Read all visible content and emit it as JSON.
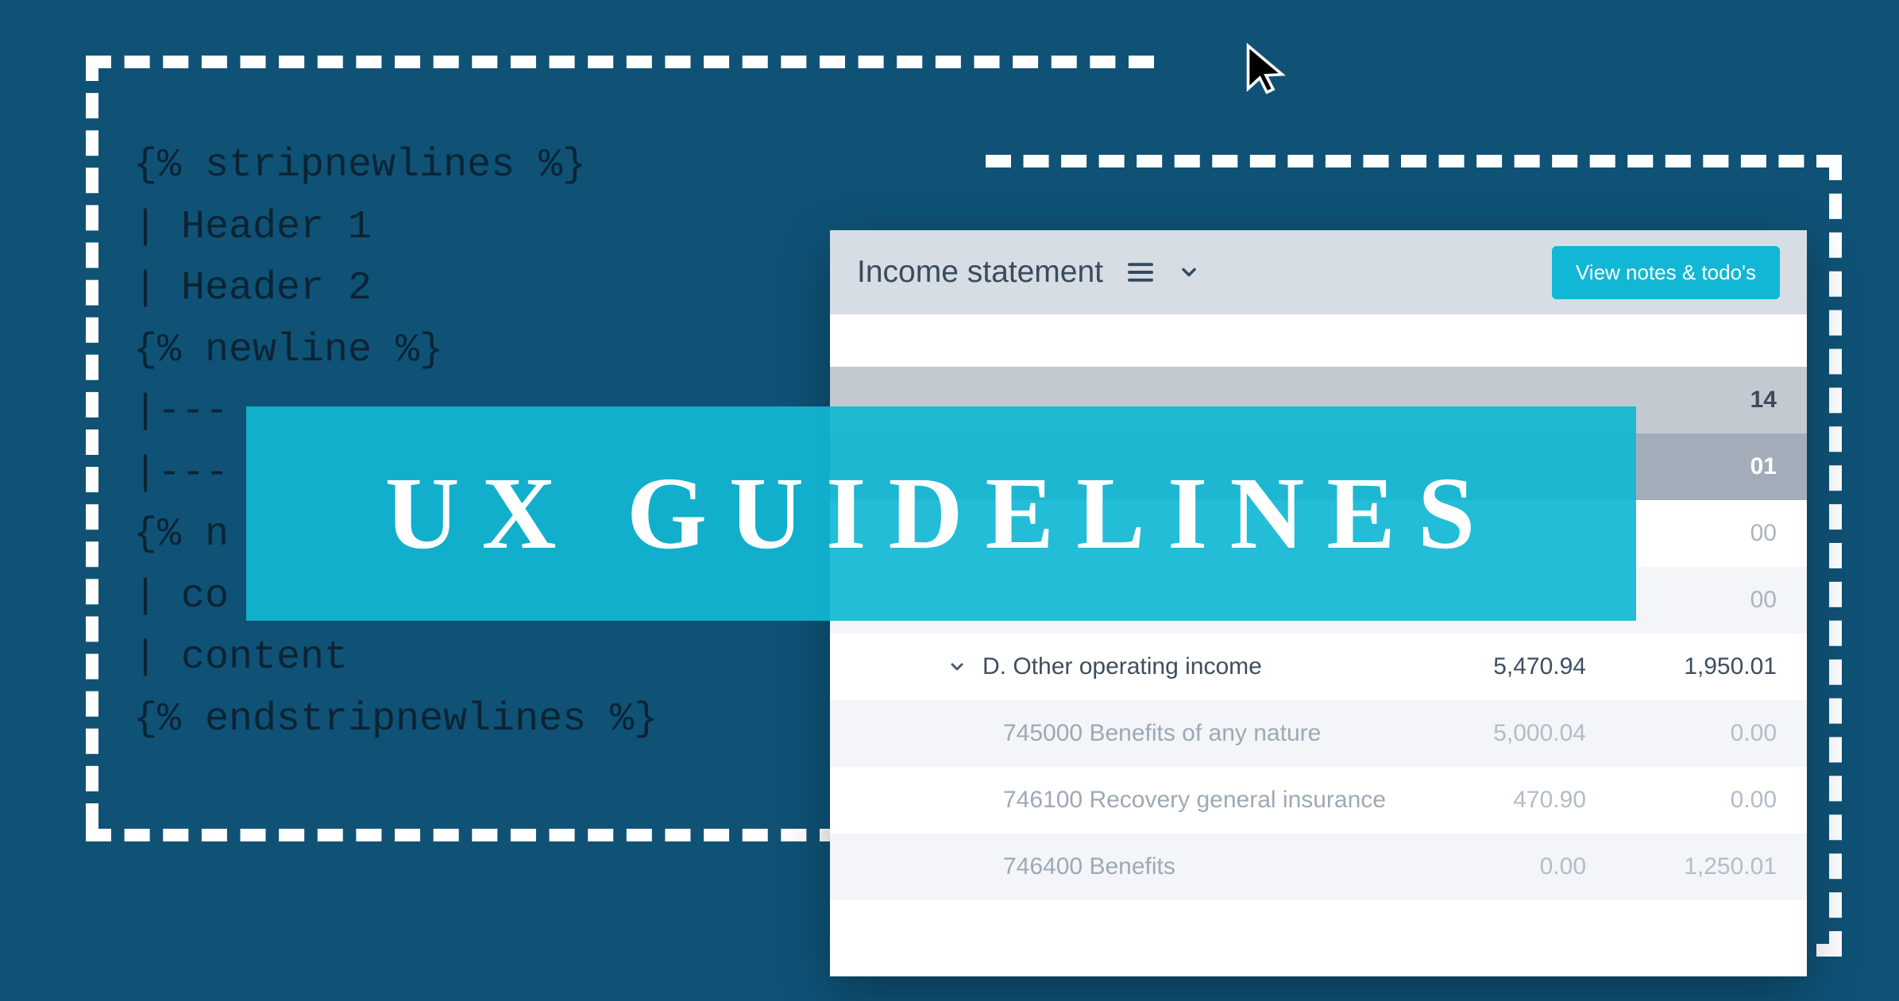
{
  "code": {
    "lines": [
      "{% stripnewlines %}",
      "| Header 1",
      "| Header 2",
      "{% newline %}",
      "|---",
      "|---",
      "{% n",
      "| co",
      "| content",
      "{% endstripnewlines %}"
    ]
  },
  "panel": {
    "title": "Income statement",
    "view_btn": "View notes & todo's",
    "stubs": {
      "s1": "14",
      "s2": "01",
      "s3": "00",
      "s4": "00"
    },
    "rows": [
      {
        "type": "parent",
        "label": "D. Other operating income",
        "v1": "5,470.94",
        "v2": "1,950.01"
      },
      {
        "type": "child",
        "label": "745000 Benefits of any nature",
        "v1": "5,000.04",
        "v2": "0.00"
      },
      {
        "type": "child",
        "label": "746100 Recovery general insurance",
        "v1": "470.90",
        "v2": "0.00"
      },
      {
        "type": "child",
        "label": "746400 Benefits",
        "v1": "0.00",
        "v2": "1,250.01"
      }
    ]
  },
  "banner": "UX GUIDELINES"
}
